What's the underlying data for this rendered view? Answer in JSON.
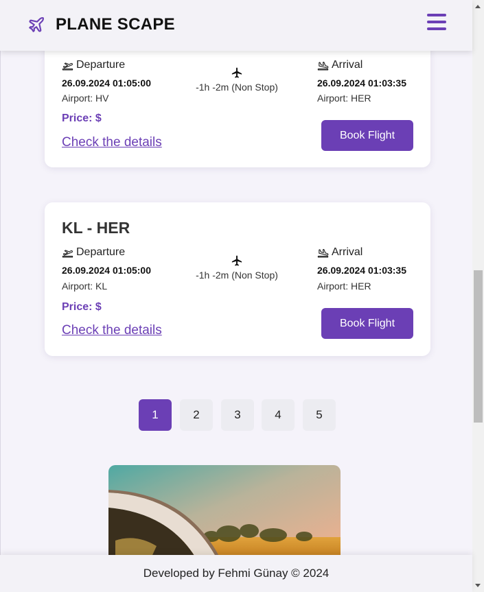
{
  "header": {
    "brand": "PLANE SCAPE"
  },
  "flights": [
    {
      "title": "",
      "departure_label": "Departure",
      "departure_time": "26.09.2024 01:05:00",
      "departure_airport": "Airport: HV",
      "duration": "-1h -2m (Non Stop)",
      "arrival_label": "Arrival",
      "arrival_time": "26.09.2024 01:03:35",
      "arrival_airport": "Airport: HER",
      "price": "Price: $",
      "details_link": "Check the details",
      "book_label": "Book Flight"
    },
    {
      "title": "KL - HER",
      "departure_label": "Departure",
      "departure_time": "26.09.2024 01:05:00",
      "departure_airport": "Airport: KL",
      "duration": "-1h -2m (Non Stop)",
      "arrival_label": "Arrival",
      "arrival_time": "26.09.2024 01:03:35",
      "arrival_airport": "Airport: HER",
      "price": "Price: $",
      "details_link": "Check the details",
      "book_label": "Book Flight"
    }
  ],
  "pagination": {
    "pages": [
      "1",
      "2",
      "3",
      "4",
      "5"
    ],
    "active": "1"
  },
  "footer": {
    "text": "Developed by Fehmi Günay © 2024"
  },
  "colors": {
    "accent": "#6b3fb5",
    "background": "#f5f3fa"
  }
}
